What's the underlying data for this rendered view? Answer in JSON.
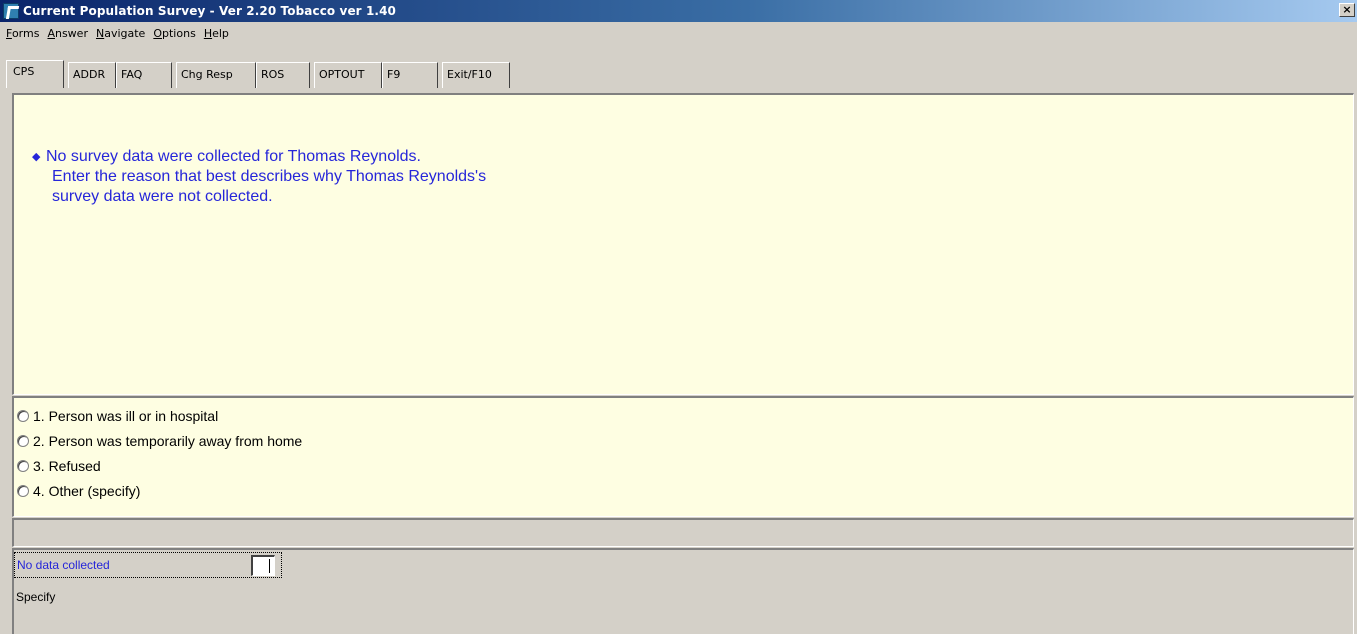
{
  "window": {
    "title": "Current Population Survey - Ver 2.20 Tobacco ver 1.40",
    "close_glyph": "×"
  },
  "menu": [
    {
      "accel": "F",
      "rest": "orms"
    },
    {
      "accel": "A",
      "rest": "nswer"
    },
    {
      "accel": "N",
      "rest": "avigate"
    },
    {
      "accel": "O",
      "rest": "ptions"
    },
    {
      "accel": "H",
      "rest": "elp"
    }
  ],
  "tabs": [
    "CPS",
    "ADDR",
    "FAQ",
    "Chg Resp",
    "ROS",
    "OPTOUT",
    "F9",
    "Exit/F10"
  ],
  "question": {
    "bullet": "◆",
    "line1": "No survey data were collected for Thomas Reynolds.",
    "line2": "Enter the reason that best describes why Thomas Reynolds's",
    "line3": "survey data were not collected."
  },
  "answers": [
    "1. Person was ill or in hospital",
    "2. Person was temporarily away from home",
    "3. Refused",
    "4. Other (specify)"
  ],
  "bottom": {
    "field_label": "No data collected",
    "field_value": "",
    "specify_label": "Specify"
  },
  "colors": {
    "panel_bg": "#fefee2",
    "question_text": "#2626d9",
    "chrome": "#d4d0c8"
  }
}
